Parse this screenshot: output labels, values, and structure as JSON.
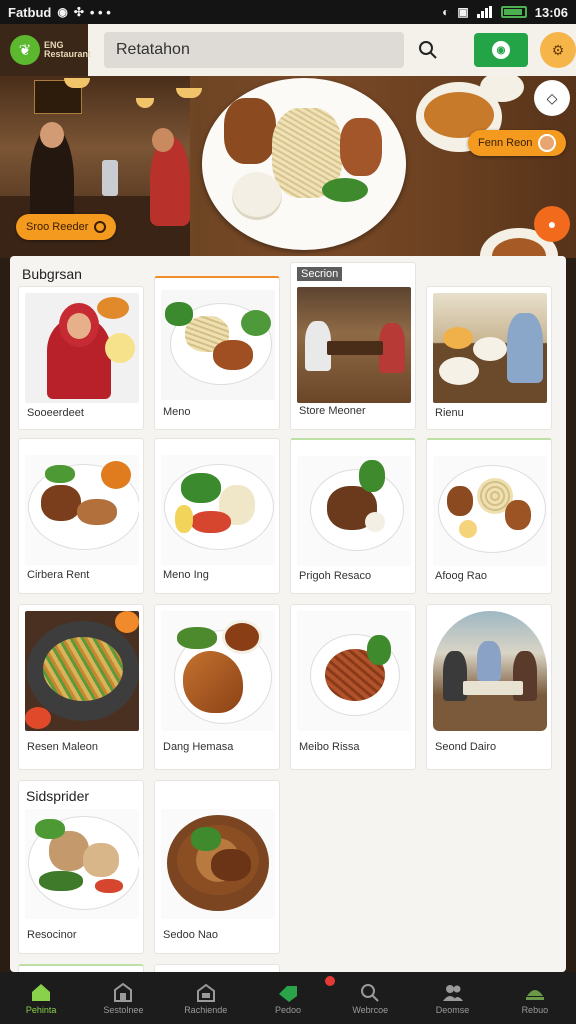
{
  "status_bar": {
    "carrier": "Fatbud",
    "dots": "• • •",
    "time": "13:06"
  },
  "app_bar": {
    "logo_text": "ENG\nRestaurant",
    "search_placeholder": "Retatahon"
  },
  "hero": {
    "left_pill": "Sroo Reeder",
    "right_pill": "Fenn Reon"
  },
  "sections": [
    {
      "title": "Bubgrsan",
      "cards": [
        {
          "label": "Sooeerdeet",
          "name": "card-sooeerdeet"
        },
        {
          "label": "Meno",
          "name": "card-meno"
        },
        {
          "label": "Store Meoner",
          "tag": "Secrion",
          "name": "card-store-meoner"
        },
        {
          "label": "Rienu",
          "name": "card-rienu"
        }
      ]
    },
    {
      "title": "",
      "cards": [
        {
          "label": "Cirbera Rent",
          "name": "card-cirbera-rent"
        },
        {
          "label": "Meno Ing",
          "name": "card-meno-ing"
        },
        {
          "label": "Prigoh Resaco",
          "name": "card-prigoh-resaco"
        },
        {
          "label": "Afoog Rao",
          "name": "card-afoog-rao"
        }
      ]
    },
    {
      "title": "",
      "cards": [
        {
          "label": "Resen Maleon",
          "name": "card-resen-maleon"
        },
        {
          "label": "Dang Hemasa",
          "name": "card-dang-hemasa"
        },
        {
          "label": "Meibo Rissa",
          "name": "card-meibo-rissa"
        },
        {
          "label": "Seond Dairo",
          "name": "card-seond-dairo"
        }
      ]
    },
    {
      "title": "Sidsprider",
      "cards": [
        {
          "label": "Resocinor",
          "name": "card-resocinor"
        },
        {
          "label": "Sedoo Nao",
          "name": "card-sedoo-nao"
        }
      ]
    }
  ],
  "bottom_nav": [
    {
      "label": "Pehinta",
      "icon": "home-icon",
      "active": true
    },
    {
      "label": "Sestolnee",
      "icon": "store-icon",
      "active": false
    },
    {
      "label": "Rachiende",
      "icon": "building-icon",
      "active": false
    },
    {
      "label": "Pedoo",
      "icon": "tag-icon",
      "active": false,
      "badge": true
    },
    {
      "label": "Webrcoe",
      "icon": "search-icon",
      "active": false
    },
    {
      "label": "Deomse",
      "icon": "people-icon",
      "active": false
    },
    {
      "label": "Rebuo",
      "icon": "dish-icon",
      "active": false
    }
  ],
  "colors": {
    "accent_orange": "#f39a1f",
    "accent_green": "#22a447",
    "nav_active": "#8ad14b"
  }
}
